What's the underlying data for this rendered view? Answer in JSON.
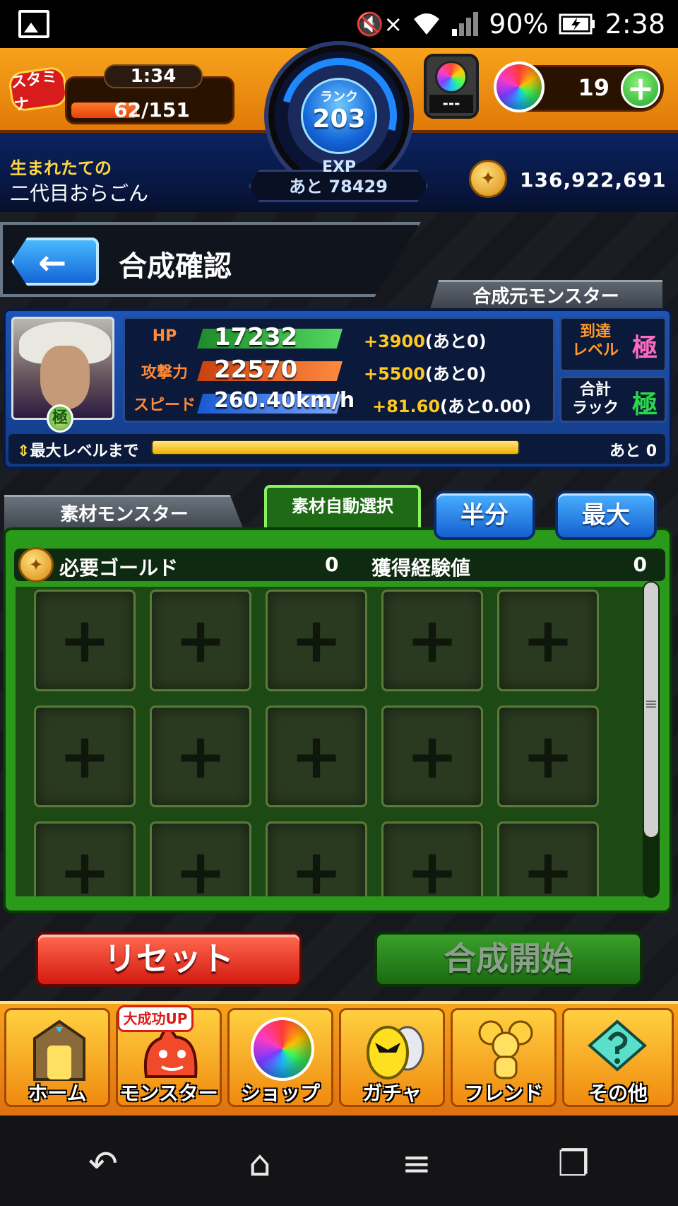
{
  "status_bar": {
    "battery": "90%",
    "time": "2:38",
    "mute": "🔇×",
    "wifi": "wifi-icon",
    "signal": "signal-icon"
  },
  "hud": {
    "stamina_label": "スタミナ",
    "stamina_timer": "1:34",
    "stamina_value": "62/151",
    "stamina_fraction": 0.41,
    "rank_label": "ランク",
    "rank": "203",
    "exp_label": "EXP",
    "exp_remaining": "あと 78429",
    "gauge_value": "---",
    "orbs": "19",
    "orb_plus": "+",
    "title_small": "生まれたての",
    "player_name": "二代目おらごん",
    "gold": "136,922,691"
  },
  "header": {
    "back": "←",
    "title": "合成確認",
    "source_tab": "合成元モンスター"
  },
  "monster": {
    "badge": "極",
    "stats": [
      {
        "name": "HP",
        "value": "17232",
        "plus": "+3900",
        "rest": "(あと0)",
        "color": "#2bbd36"
      },
      {
        "name": "攻撃力",
        "value": "22570",
        "plus": "+5500",
        "rest": "(あと0)",
        "color": "#f06a1a"
      },
      {
        "name": "スピード",
        "value": "260.40km/h",
        "plus": "+81.60",
        "rest": "(あと0.00)",
        "color": "#2a78f0"
      }
    ],
    "level_label": "到達\nレベル",
    "level_value": "極",
    "luck_label": "合計\nラック",
    "luck_value": "極",
    "max_label": "最大レベルまで",
    "max_fraction": 1.0,
    "max_rest": "あと 0"
  },
  "materials": {
    "tab1": "素材モンスター",
    "tab2": "素材自動選択",
    "half_button": "半分",
    "max_button": "最大",
    "gold_label": "必要ゴールド",
    "gold_value": "0",
    "exp_label": "獲得経験値",
    "exp_value": "0",
    "slot_symbol": "+"
  },
  "actions": {
    "reset": "リセット",
    "start": "合成開始"
  },
  "nav": {
    "badge": "大成功UP",
    "items": [
      "ホーム",
      "モンスター",
      "ショップ",
      "ガチャ",
      "フレンド",
      "その他"
    ]
  },
  "system_nav": {
    "back": "↶",
    "home": "⌂",
    "menu": "≡",
    "recent": "❐"
  }
}
